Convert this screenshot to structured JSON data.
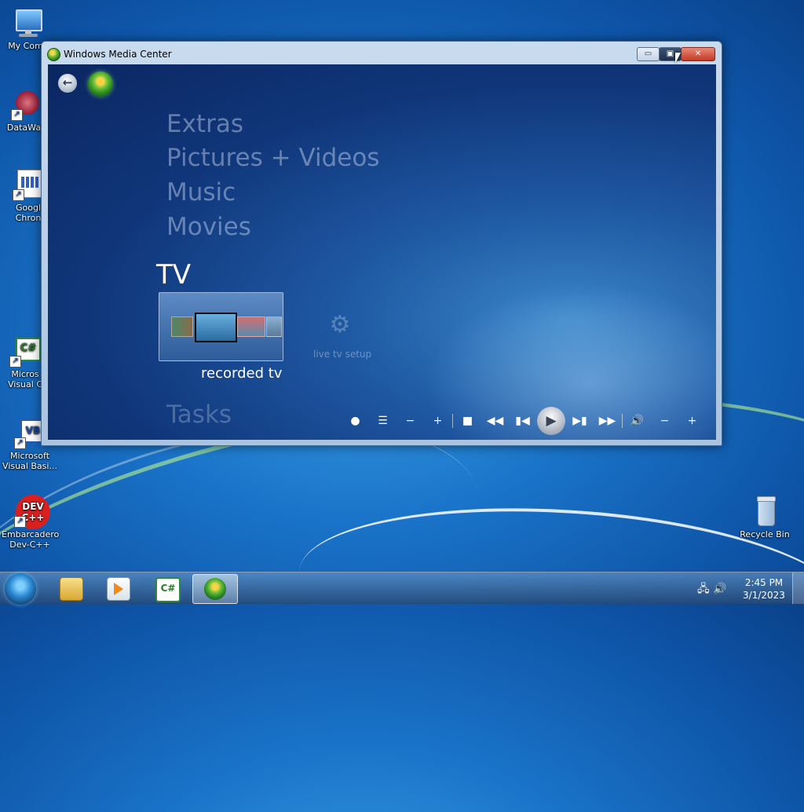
{
  "desktop": {
    "icons": [
      {
        "label": "My Comp",
        "icon": "computer-icon"
      },
      {
        "label": "DataWag",
        "icon": "datawag-app-icon"
      },
      {
        "label_line1": "Googl",
        "label_line2": "Chron",
        "icon": "chrome-shortcut-icon"
      },
      {
        "label_line1": "Micros",
        "label_line2": "Visual C",
        "icon": "visual-csharp-icon"
      },
      {
        "label_line1": "Microsoft",
        "label_line2": "Visual Basi...",
        "icon": "visual-basic-icon"
      },
      {
        "label_line1": "Embarcadero",
        "label_line2": "Dev-C++",
        "icon": "dev-cpp-icon"
      },
      {
        "label": "Recycle Bin",
        "icon": "recycle-bin-icon"
      }
    ],
    "devcpp_badge": "DEV\nC++",
    "cs_badge": "C#",
    "vb_badge": "VB"
  },
  "window": {
    "title": "Windows Media Center",
    "controls": {
      "minimize": "▭",
      "maximize": "▣",
      "close": "✕"
    }
  },
  "media_center": {
    "menu": {
      "extras": "Extras",
      "pictures_videos": "Pictures + Videos",
      "music": "Music",
      "movies": "Movies",
      "tv": "TV",
      "tasks": "Tasks"
    },
    "tv_tiles": {
      "recorded": "recorded tv",
      "setup": "live tv setup"
    },
    "transport": {
      "record": "●",
      "guide": "☰",
      "ch_down": "−",
      "ch_up": "+",
      "stop": "■",
      "rewind": "◀◀",
      "prev": "▮◀",
      "play": "▶",
      "next": "▶▮",
      "ffwd": "▶▶",
      "volume": "🔊",
      "vol_down": "−",
      "vol_up": "+"
    }
  },
  "taskbar": {
    "apps": [
      "file-explorer",
      "windows-media-player",
      "visual-csharp",
      "windows-media-center"
    ],
    "active_app": "windows-media-center",
    "clock_time": "2:45 PM",
    "clock_date": "3/1/2023",
    "tray_network": "🖧",
    "tray_volume": "🔊"
  }
}
